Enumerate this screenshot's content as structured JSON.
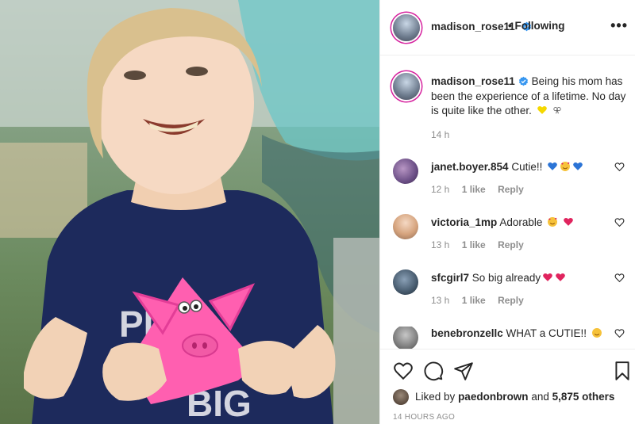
{
  "post": {
    "author": "madison_rose11",
    "follow_status": "• Following",
    "more_label": "•••",
    "caption_text": "Being his mom has been the experience of a lifetime. No day is quite like the other.",
    "caption_time": "14 h"
  },
  "photo": {
    "shirt_text_top": "PIG",
    "shirt_text_bottom": "BIG"
  },
  "comments": [
    {
      "user": "janet.boyer.854",
      "text": "Cutie!!",
      "time": "12 h",
      "likes": "1 like",
      "reply": "Reply"
    },
    {
      "user": "victoria_1mp",
      "text": "Adorable",
      "time": "13 h",
      "likes": "1 like",
      "reply": "Reply"
    },
    {
      "user": "sfcgirl7",
      "text": "So big already",
      "time": "13 h",
      "likes": "1 like",
      "reply": "Reply"
    },
    {
      "user": "benebronzellc",
      "text": "WHAT a CUTIE!!"
    }
  ],
  "footer": {
    "liked_prefix": "Liked by",
    "liked_user": "paedonbrown",
    "liked_mid": "and",
    "liked_count": "5,875 others",
    "timestamp": "14 HOURS AGO"
  },
  "colors": {
    "verified": "#3897f0",
    "ring": "#d6249f",
    "muted": "#8e8e8e",
    "text": "#262626",
    "pig_pink": "#ff5fb0",
    "shirt_navy": "#1d2a5c"
  },
  "icons": [
    "verified-icon",
    "more-icon",
    "heart-icon",
    "comment-icon",
    "share-icon",
    "bookmark-icon"
  ]
}
